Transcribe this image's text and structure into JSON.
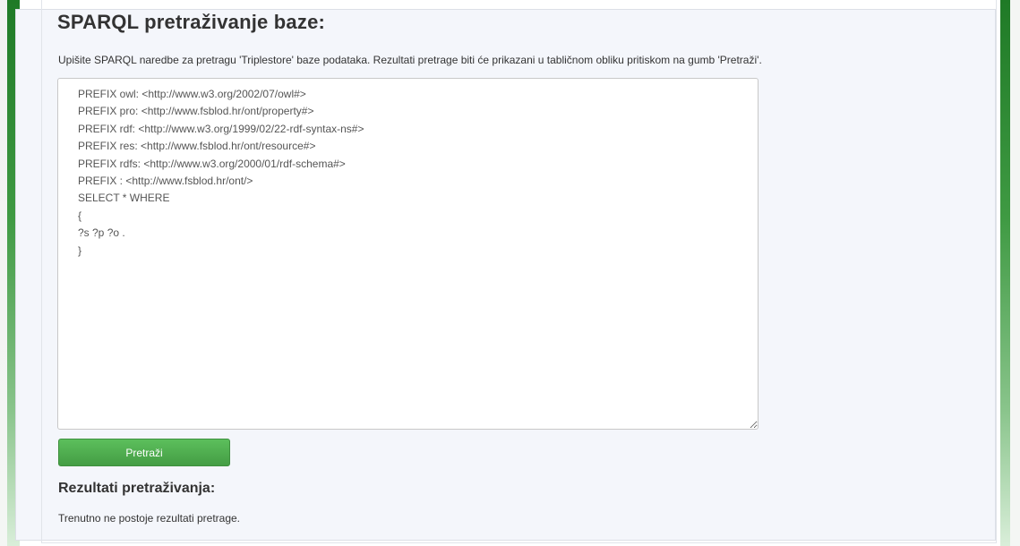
{
  "page": {
    "title": "SPARQL pretraživanje baze:",
    "description": "Upišite SPARQL naredbe za pretragu 'Triplestore' baze podataka. Rezultati pretrage biti će prikazani u tabličnom obliku pritiskom na gumb 'Pretraži'."
  },
  "query_editor": {
    "value": "PREFIX owl: <http://www.w3.org/2002/07/owl#>\nPREFIX pro: <http://www.fsblod.hr/ont/property#>\nPREFIX rdf: <http://www.w3.org/1999/02/22-rdf-syntax-ns#>\nPREFIX res: <http://www.fsblod.hr/ont/resource#>\nPREFIX rdfs: <http://www.w3.org/2000/01/rdf-schema#>\nPREFIX : <http://www.fsblod.hr/ont/>\nSELECT * WHERE\n{\n?s ?p ?o .\n}"
  },
  "search_button": {
    "label": "Pretraži"
  },
  "results": {
    "title": "Rezultati pretraživanja:",
    "message": "Trenutno ne postoje rezultati pretrage."
  },
  "colors": {
    "accent_green": "#449d44",
    "background_green": "#1f7a26",
    "panel_background": "#f4f6fb",
    "text": "#333333"
  }
}
